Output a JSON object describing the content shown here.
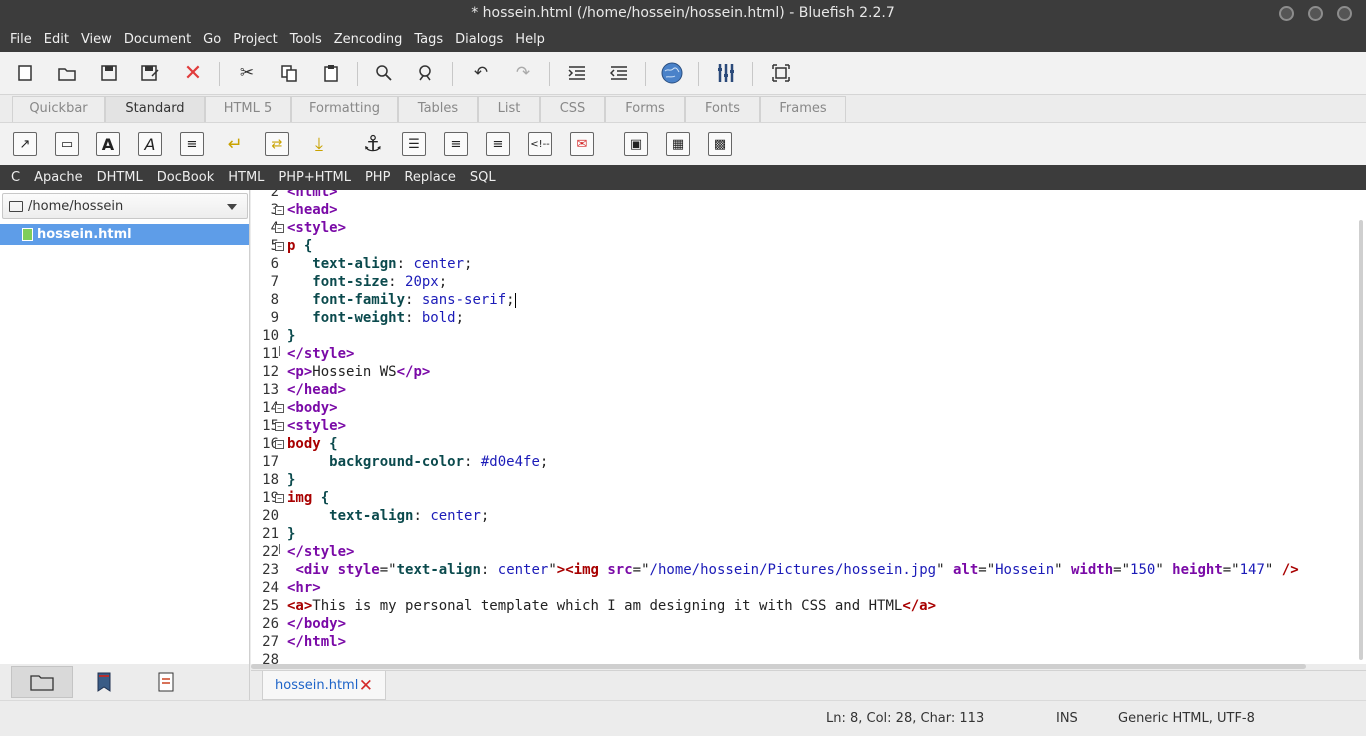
{
  "window": {
    "title": "* hossein.html (/home/hossein/hossein.html) - Bluefish 2.2.7"
  },
  "menu": [
    "File",
    "Edit",
    "View",
    "Document",
    "Go",
    "Project",
    "Tools",
    "Zencoding",
    "Tags",
    "Dialogs",
    "Help"
  ],
  "toolbar": {
    "icons": [
      "new-file-icon",
      "open-folder-icon",
      "save-icon",
      "save-as-icon",
      "close-icon",
      "cut-icon",
      "copy-icon",
      "paste-icon",
      "search-icon",
      "advanced-search-icon",
      "undo-icon",
      "redo-icon",
      "indent-icon",
      "unindent-icon",
      "preview-globe-icon",
      "preferences-icon",
      "fullscreen-icon"
    ]
  },
  "tabs": [
    "Quickbar",
    "Standard",
    "HTML 5",
    "Formatting",
    "Tables",
    "List",
    "CSS",
    "Forms",
    "Fonts",
    "Frames"
  ],
  "active_tab": "Standard",
  "snippets": [
    "C",
    "Apache",
    "DHTML",
    "DocBook",
    "HTML",
    "PHP+HTML",
    "PHP",
    "Replace",
    "SQL"
  ],
  "sidebar": {
    "path": "/home/hossein",
    "selected_file": "hossein.html"
  },
  "editor": {
    "lines": [
      {
        "n": "2",
        "html": "<span class='t'>&lt;html&gt;</span>"
      },
      {
        "n": "3",
        "html": "<span class='t'>&lt;head&gt;</span>"
      },
      {
        "n": "4",
        "html": "<span class='t'>&lt;style&gt;</span>"
      },
      {
        "n": "5",
        "html": "<span class='tr'>p</span> <span class='p'>{</span>"
      },
      {
        "n": "6",
        "html": "   <span class='p'>text-align</span>: <span class='v'>center</span>;"
      },
      {
        "n": "7",
        "html": "   <span class='p'>font-size</span>: <span class='v'>20px</span>;"
      },
      {
        "n": "8",
        "html": "   <span class='p'>font-family</span>: <span class='v'>sans-serif</span>;"
      },
      {
        "n": "9",
        "html": "   <span class='p'>font-weight</span>: <span class='v'>bold</span>;"
      },
      {
        "n": "10",
        "html": "<span class='p'>}</span>"
      },
      {
        "n": "11",
        "html": "<span class='t'>&lt;/style&gt;</span>"
      },
      {
        "n": "12",
        "html": "<span class='t'>&lt;p&gt;</span>Hossein WS<span class='t'>&lt;/p&gt;</span>"
      },
      {
        "n": "13",
        "html": "<span class='t'>&lt;/head&gt;</span>"
      },
      {
        "n": "14",
        "html": "<span class='t'>&lt;body&gt;</span>"
      },
      {
        "n": "15",
        "html": "<span class='t'>&lt;style&gt;</span>"
      },
      {
        "n": "16",
        "html": "<span class='tr'>body</span> <span class='p'>{</span>"
      },
      {
        "n": "17",
        "html": "     <span class='p'>background-color</span>: <span class='v'>#d0e4fe</span>;"
      },
      {
        "n": "18",
        "html": "<span class='p'>}</span>"
      },
      {
        "n": "19",
        "html": "<span class='tr'>img</span> <span class='p'>{</span>"
      },
      {
        "n": "20",
        "html": "     <span class='p'>text-align</span>: <span class='v'>center</span>;"
      },
      {
        "n": "21",
        "html": "<span class='p'>}</span>"
      },
      {
        "n": "22",
        "html": "<span class='t'>&lt;/style&gt;</span>"
      },
      {
        "n": "23",
        "html": " <span class='t'>&lt;div</span> <span class='t'>style</span>=\"<span class='p'>text-align</span>: <span class='v'>center</span>\"<span class='tr'>&gt;&lt;img</span> <span class='t'>src</span>=\"<span class='d'>/home/hossein/Pictures/hossein.jpg</span>\" <span class='t'>alt</span>=\"<span class='d'>Hossein</span>\" <span class='t'>width</span>=\"<span class='d'>150</span>\" <span class='t'>height</span>=\"<span class='d'>147</span>\" <span class='tr'>/&gt;</span>"
      },
      {
        "n": "24",
        "html": "<span class='t'>&lt;hr&gt;</span>"
      },
      {
        "n": "25",
        "html": "<span class='tr'>&lt;a&gt;</span>This is my personal template which I am designing it with CSS and HTML<span class='tr'>&lt;/a&gt;</span>"
      },
      {
        "n": "26",
        "html": "<span class='t'>&lt;/body&gt;</span>"
      },
      {
        "n": "27",
        "html": "<span class='t'>&lt;/html&gt;</span>"
      },
      {
        "n": "28",
        "html": ""
      }
    ]
  },
  "doc_tab": {
    "label": "hossein.html"
  },
  "status": {
    "position": "Ln: 8, Col: 28, Char: 113",
    "mode": "INS",
    "encoding": "Generic HTML, UTF-8"
  }
}
